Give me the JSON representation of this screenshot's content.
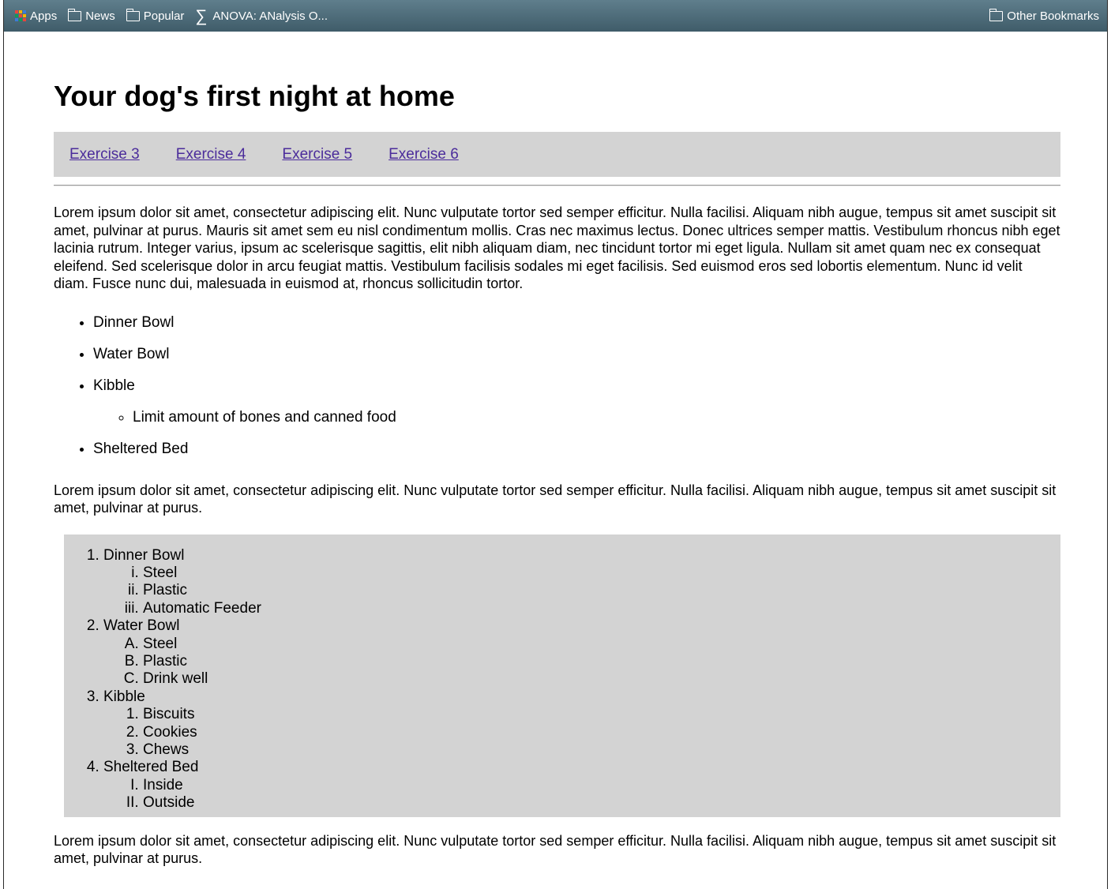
{
  "bookmarks": {
    "items": [
      {
        "label": "Apps",
        "icon": "apps-grid-icon"
      },
      {
        "label": "News",
        "icon": "folder-icon"
      },
      {
        "label": "Popular",
        "icon": "folder-icon"
      },
      {
        "label": "ANOVA: ANalysis O...",
        "icon": "sigma-icon"
      }
    ],
    "other": "Other Bookmarks"
  },
  "page": {
    "title": "Your dog's first night at home",
    "nav": [
      "Exercise 3",
      "Exercise 4",
      "Exercise 5",
      "Exercise 6"
    ],
    "para1": "Lorem ipsum dolor sit amet, consectetur adipiscing elit. Nunc vulputate tortor sed semper efficitur. Nulla facilisi. Aliquam nibh augue, tempus sit amet suscipit sit amet, pulvinar at purus. Mauris sit amet sem eu nisl condimentum mollis. Cras nec maximus lectus. Donec ultrices semper mattis. Vestibulum rhoncus nibh eget lacinia rutrum. Integer varius, ipsum ac scelerisque sagittis, elit nibh aliquam diam, nec tincidunt tortor mi eget ligula. Nullam sit amet quam nec ex consequat eleifend. Sed scelerisque dolor in arcu feugiat mattis. Vestibulum facilisis sodales mi eget facilisis. Sed euismod eros sed lobortis elementum. Nunc id velit diam. Fusce nunc dui, malesuada in euismod at, rhoncus sollicitudin tortor.",
    "ul": [
      "Dinner Bowl",
      "Water Bowl",
      "Kibble",
      "Sheltered Bed"
    ],
    "ul_sub": "Limit amount of bones and canned food",
    "para2": "Lorem ipsum dolor sit amet, consectetur adipiscing elit. Nunc vulputate tortor sed semper efficitur. Nulla facilisi. Aliquam nibh augue, tempus sit amet suscipit sit amet, pulvinar at purus.",
    "ol": [
      {
        "label": "Dinner Bowl",
        "sub": [
          "Steel",
          "Plastic",
          "Automatic Feeder"
        ]
      },
      {
        "label": "Water Bowl",
        "sub": [
          "Steel",
          "Plastic",
          "Drink well"
        ]
      },
      {
        "label": "Kibble",
        "sub": [
          "Biscuits",
          "Cookies",
          "Chews"
        ]
      },
      {
        "label": "Sheltered Bed",
        "sub": [
          "Inside",
          "Outside"
        ]
      }
    ],
    "para3": "Lorem ipsum dolor sit amet, consectetur adipiscing elit. Nunc vulputate tortor sed semper efficitur. Nulla facilisi. Aliquam nibh augue, tempus sit amet suscipit sit amet, pulvinar at purus."
  },
  "colors": {
    "link": "#4b2c9b",
    "panel": "#d3d3d3",
    "bookmark_bar": "#4d6b78"
  }
}
